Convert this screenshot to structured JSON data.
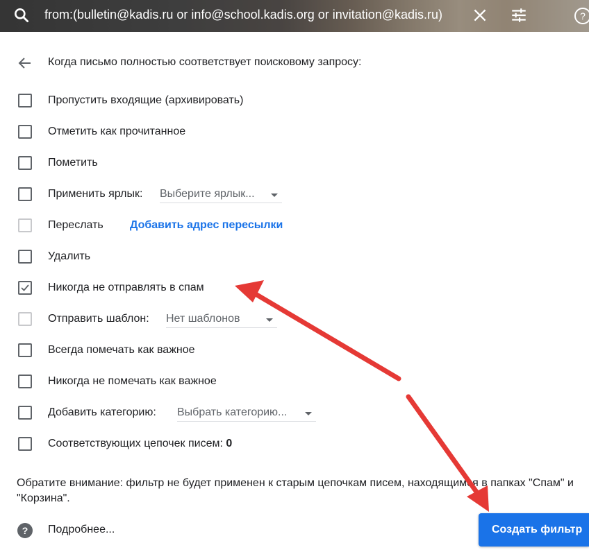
{
  "search": {
    "query": "from:(bulletin@kadis.ru or info@school.kadis.org or invitation@kadis.ru)",
    "icons": [
      "search-icon",
      "close-icon",
      "tune-icon",
      "help-icon"
    ]
  },
  "heading": "Когда письмо полностью соответствует поисковому запросу:",
  "options": {
    "skip_inbox": "Пропустить входящие (архивировать)",
    "mark_read": "Отметить как прочитанное",
    "star": "Пометить",
    "apply_label": "Применить ярлык:",
    "apply_label_select": "Выберите ярлык...",
    "forward": "Переслать",
    "forward_link": "Добавить адрес пересылки",
    "delete": "Удалить",
    "never_spam": "Никогда не отправлять в спам",
    "send_template": "Отправить шаблон:",
    "send_template_select": "Нет шаблонов",
    "always_important": "Всегда помечать как важное",
    "never_important": "Никогда не помечать как важное",
    "add_category": "Добавить категорию:",
    "add_category_select": "Выбрать категорию...",
    "matching_threads": "Соответствующих цепочек писем:",
    "matching_threads_count": "0"
  },
  "checked": {
    "never_spam": true
  },
  "note": "Обратите внимание: фильтр не будет применен к старым цепочкам писем, находящимся в папках \"Спам\" и \"Корзина\".",
  "learn_more": "Подробнее...",
  "create_button": "Создать фильтр",
  "colors": {
    "accent": "#1a73e8",
    "arrow": "#e53935"
  }
}
